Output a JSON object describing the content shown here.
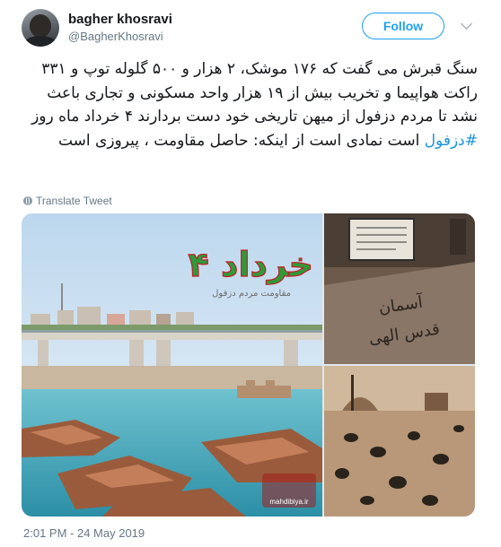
{
  "tweet": {
    "display_name": "bagher khosravi",
    "handle": "@BagherKhosravi",
    "follow_label": "Follow",
    "text_before_hashtag": "سنگ قبرش  می گفت که ۱۷۶ موشک، ۲ هزار و ۵۰۰ گلوله توپ و ۳۳۱ راکت هواپیما و تخریب بیش از ۱۹ هزار واحد مسکونی و تجاری باعث نشد تا مردم دزفول از میهن تاریخی خود دست بردارند ۴ خرداد ماه روز ",
    "hashtag": "#دزفول",
    "text_after_hashtag": " است نمادی است از اینکه: حاصل  مقاومت ، پیروزی است",
    "translate_label": "Translate Tweet",
    "timestamp": "2:01 PM - 24 May 2019"
  },
  "media": {
    "poster_title": "۴ خرداد",
    "poster_subtitle": "مقاومت مردم دزفول",
    "watermark": "mahdibiya.ir",
    "grave_text_lines": [
      "آسمان",
      "قدس الهی"
    ]
  },
  "colors": {
    "accent": "#1da1f2",
    "hashtag": "#1b95e0",
    "secondary_text": "#657786"
  },
  "icons": {
    "globe": "globe-icon",
    "chevron": "chevron-down-icon"
  }
}
